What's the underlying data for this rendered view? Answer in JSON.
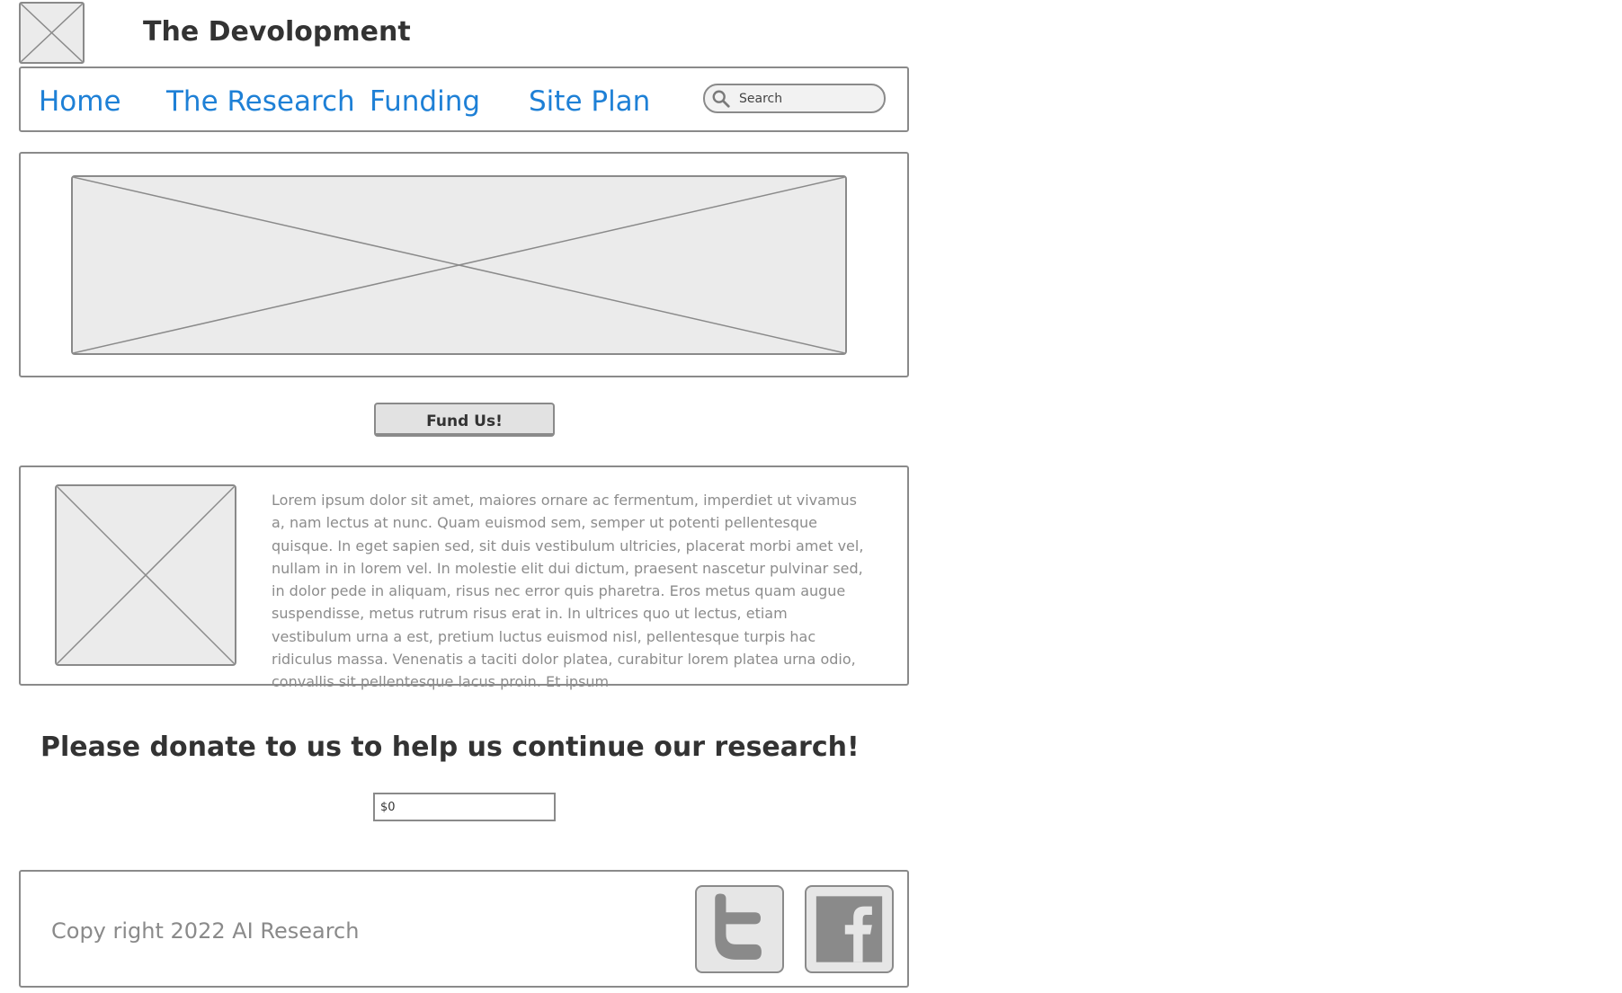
{
  "header": {
    "logo_icon": "image-placeholder-icon",
    "site_title": "The Devolopment"
  },
  "nav": {
    "items": [
      {
        "label": "Home"
      },
      {
        "label": "The Research"
      },
      {
        "label": "Funding"
      },
      {
        "label": "Site Plan"
      }
    ],
    "link_color": "#1e80d6",
    "search": {
      "icon": "search-icon",
      "placeholder": "Search"
    }
  },
  "hero": {
    "image_icon": "image-placeholder-icon"
  },
  "fund_button": {
    "label": "Fund Us!"
  },
  "content": {
    "image_icon": "image-placeholder-icon",
    "paragraph": "Lorem ipsum dolor sit amet, maiores ornare ac fermentum, imperdiet ut vivamus a, nam lectus at nunc. Quam euismod sem, semper ut potenti pellentesque quisque. In eget sapien sed, sit duis vestibulum ultricies, placerat morbi amet vel, nullam in in lorem vel. In molestie elit dui dictum, praesent nascetur pulvinar sed, in dolor pede in aliquam, risus nec error quis pharetra. Eros metus quam augue suspendisse, metus rutrum risus erat in.  In ultrices quo ut lectus, etiam vestibulum urna a est, pretium luctus euismod nisl, pellentesque turpis hac ridiculus massa. Venenatis a taciti dolor platea, curabitur lorem platea urna odio, convallis sit pellentesque lacus proin. Et ipsum"
  },
  "donate": {
    "heading": "Please donate to us to help us continue our research!",
    "amount_value": "$0"
  },
  "footer": {
    "copyright": "Copy right 2022 AI Research",
    "social": [
      {
        "icon": "twitter-icon"
      },
      {
        "icon": "facebook-icon"
      }
    ]
  }
}
